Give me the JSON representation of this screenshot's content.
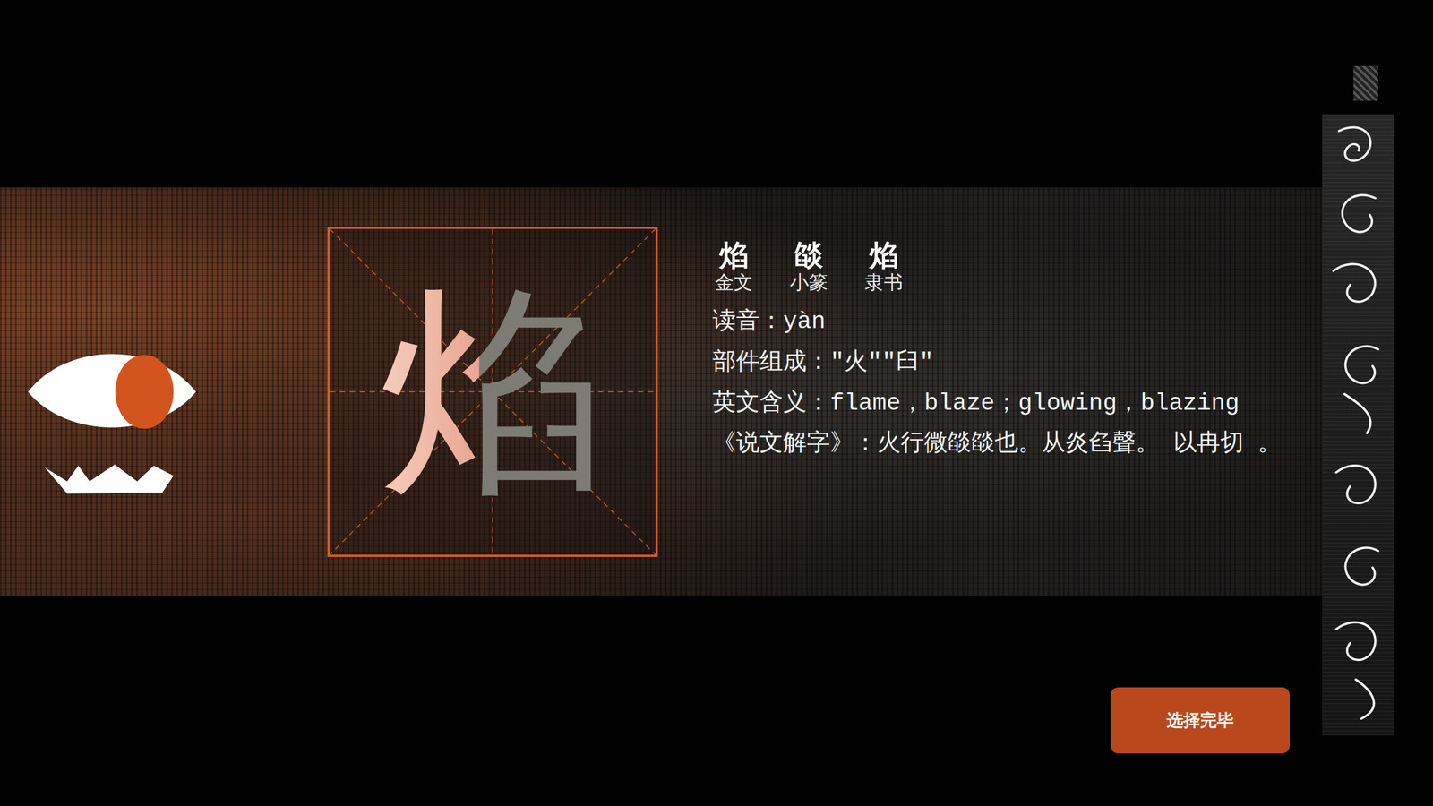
{
  "character": {
    "glyph": "焰"
  },
  "scripts": [
    {
      "glyph": "焰",
      "label": "金文"
    },
    {
      "glyph": "燄",
      "label": "小篆"
    },
    {
      "glyph": "焰",
      "label": "隶书"
    }
  ],
  "info": [
    "读音：yàn",
    "部件组成：″火″″臼″",
    "英文含义：flame，blaze；glowing，blazing",
    "《说文解字》：火行微燄燄也。从炎臽聲。 以冉切 。"
  ],
  "buttons": [
    "选择完毕"
  ]
}
